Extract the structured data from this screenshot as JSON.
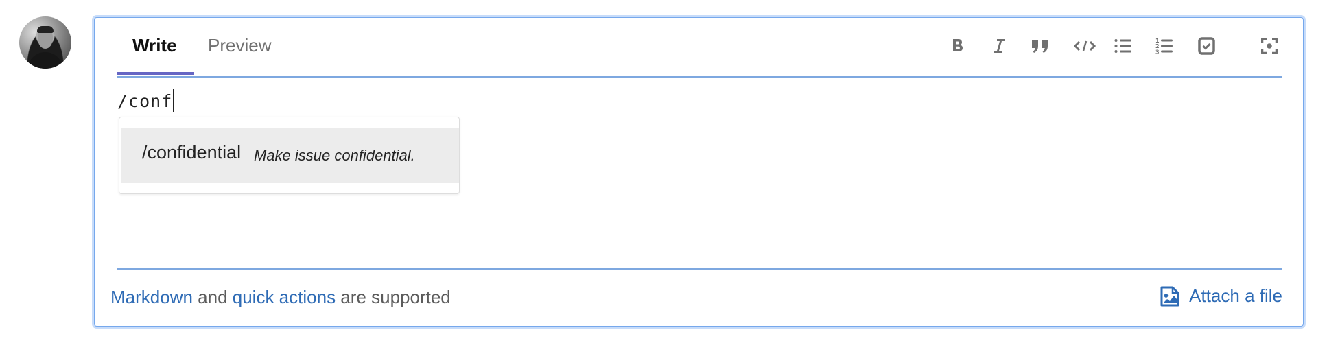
{
  "user": {
    "avatar_icon": "user-avatar"
  },
  "editor": {
    "tabs": [
      {
        "label": "Write",
        "active": true
      },
      {
        "label": "Preview",
        "active": false
      }
    ],
    "toolbar": [
      {
        "name": "bold-icon",
        "title": "Bold"
      },
      {
        "name": "italic-icon",
        "title": "Italic"
      },
      {
        "name": "quote-icon",
        "title": "Quote"
      },
      {
        "name": "code-icon",
        "title": "Code"
      },
      {
        "name": "bulleted-list-icon",
        "title": "Bulleted list"
      },
      {
        "name": "numbered-list-icon",
        "title": "Numbered list"
      },
      {
        "name": "task-list-icon",
        "title": "Task list"
      },
      {
        "name": "fullscreen-icon",
        "title": "Fullscreen"
      }
    ],
    "text_value": "/conf",
    "autocomplete": {
      "items": [
        {
          "command": "/confidential",
          "description": "Make issue confidential."
        }
      ]
    },
    "footer": {
      "markdown_link": "Markdown",
      "and_text": " and ",
      "quick_actions_link": "quick actions",
      "supported_text": " are supported",
      "attach_label": "Attach a file"
    }
  },
  "colors": {
    "link": "#2e6bb5",
    "focus_border": "#76a8ec",
    "active_tab_underline": "#6666c4",
    "icon": "#707070"
  }
}
